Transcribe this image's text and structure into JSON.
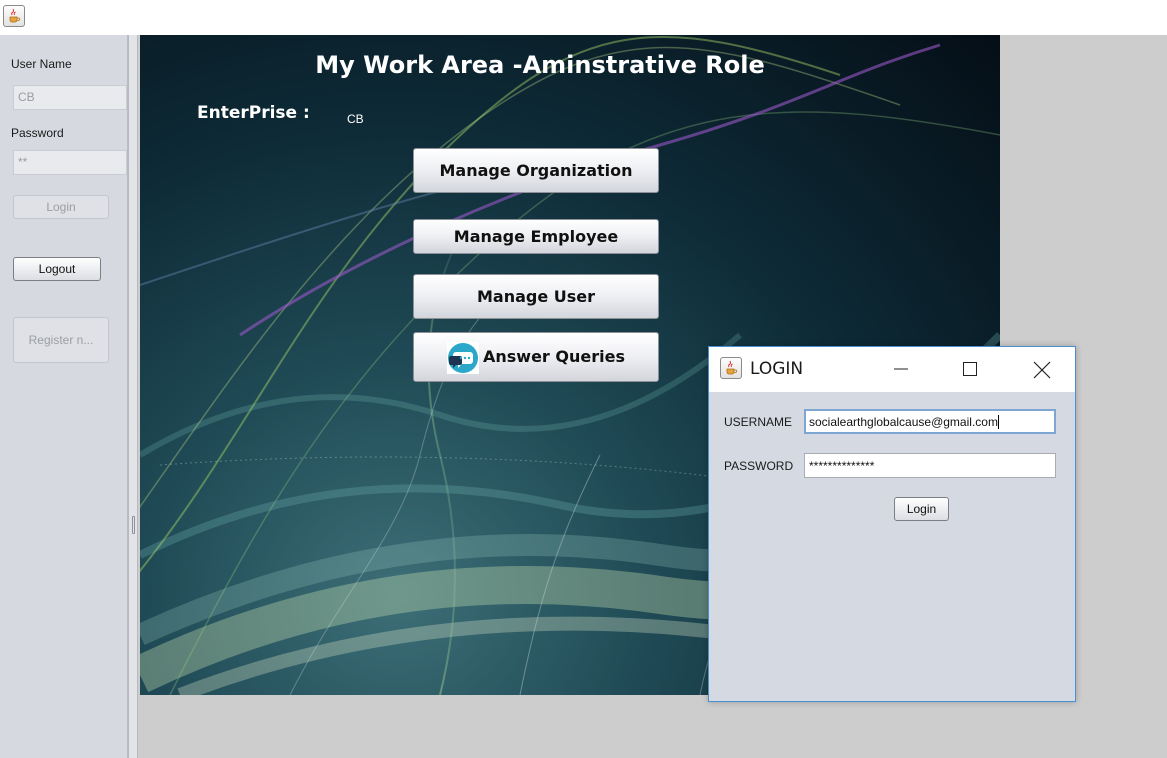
{
  "main_window": {
    "icon": "java-coffee-cup-icon"
  },
  "left_panel": {
    "username_label": "User Name",
    "username_value": "CB",
    "password_label": "Password",
    "password_value": "**",
    "login_label": "Login",
    "logout_label": "Logout",
    "register_label": "Register n..."
  },
  "work_area": {
    "title": "My Work Area -Aminstrative Role",
    "enterprise_label": "EnterPrise :",
    "enterprise_value": "CB",
    "buttons": {
      "manage_organization": "Manage Organization",
      "manage_employee": "Manage Employee",
      "manage_user": "Manage User",
      "answer_queries": "Answer Queries"
    },
    "answer_queries_icon": "chat-bubble-icon"
  },
  "login_dialog": {
    "title": "LOGIN",
    "icon": "java-coffee-cup-icon",
    "username_label": "USERNAME",
    "username_value": "socialearthglobalcause@gmail.com",
    "password_label": "PASSWORD",
    "password_value": "**************",
    "login_button": "Login",
    "accent_color": "#4a8fd0"
  }
}
